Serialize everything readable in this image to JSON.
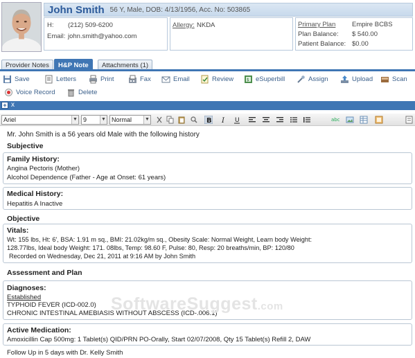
{
  "patient": {
    "name": "John Smith",
    "details": "56 Y, Male, DOB: 4/13/1956, Acc. No: 503865",
    "phone_label": "H:",
    "phone": "(212) 509-6200",
    "email_label": "Email:",
    "email": "john.smith@yahoo.com",
    "allergy_label": "Allergy:",
    "allergy": "NKDA",
    "primary_plan_label": "Primary Plan",
    "primary_plan": "Empire BCBS",
    "plan_balance_label": "Plan Balance:",
    "plan_balance": "$ 540.00",
    "patient_balance_label": "Patient Balance:",
    "patient_balance": "$0.00"
  },
  "tabs": [
    {
      "label": "Provider Notes"
    },
    {
      "label": "H&P Note"
    },
    {
      "label": "Attachments (1)"
    }
  ],
  "toolbar": {
    "save": "Save",
    "letters": "Letters",
    "print": "Print",
    "fax": "Fax",
    "email": "Email",
    "review": "Review",
    "esuperbill": "eSuperbill",
    "assign": "Assign",
    "upload": "Upload",
    "scan": "Scan",
    "voice_record": "Voice Record",
    "delete": "Delete"
  },
  "editor": {
    "plus": "+",
    "close": "x",
    "font": "Ariel",
    "size": "9",
    "style": "Normal"
  },
  "note": {
    "intro": "Mr. John Smith is a 56 years old Male with the following history",
    "subjective": "Subjective",
    "family_history": {
      "title": "Family History:",
      "lines": [
        "Angina Pectoris (Mother)",
        "Alcohol Dependence (Father - Age at Onset: 61 years)"
      ]
    },
    "medical_history": {
      "title": "Medical History:",
      "lines": [
        "Hepatitis A Inactive"
      ]
    },
    "objective": "Objective",
    "vitals": {
      "title": "Vitals:",
      "lines": [
        "Wt: 155 lbs, Ht: 6', BSA: 1.91 m sq., BMI: 21.02kg/m sq., Obesity Scale: Normal Weight, Learn body Weight:",
        "128.77lbs, Ideal body Weight: 171. 08lbs, Temp: 98.60 F, Pulse: 80, Resp: 20 breaths/min, BP: 120/80",
        "Recorded on Wednesday, Dec 21, 2011 at 9:16 AM by John Smith"
      ]
    },
    "assessment": "Assessment and Plan",
    "diagnoses": {
      "title": "Diagnoses:",
      "status": "Established",
      "lines": [
        "TYPHOID FEVER (ICD-002.0)",
        "CHRONIC INTESTINAL AMEBIASIS WITHOUT ABSCESS (ICD-.006.1)"
      ]
    },
    "medication": {
      "title": "Active Medication:",
      "lines": [
        "Amoxicillin Cap 500mg: 1 Tablet(s) QID/PRN PO-Orally, Start 02/07/2008, Qty 15 Tablet(s) Refill 2, DAW"
      ]
    },
    "follow_up": "Follow Up in 5 days with Dr. Kelly Smith"
  },
  "watermark": {
    "main": "SoftwareSuggest",
    "suffix": ".com"
  },
  "icons": {
    "save": "floppy-icon",
    "letters": "letter-icon",
    "print": "printer-icon",
    "fax": "fax-icon",
    "email": "email-icon",
    "review": "review-icon",
    "esuperbill": "superbill-icon",
    "assign": "assign-icon",
    "upload": "upload-icon",
    "scan": "scan-icon",
    "voice_record": "record-icon",
    "delete": "trash-icon"
  },
  "colors": {
    "accent": "#3f76b4",
    "name": "#2c5a9a",
    "toolbar_text": "#3a5f8a"
  }
}
